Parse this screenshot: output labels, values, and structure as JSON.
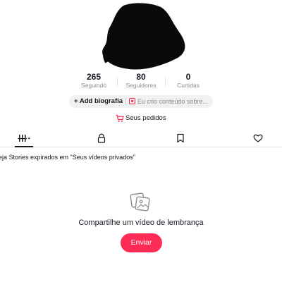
{
  "colors": {
    "accent": "#fe2c55",
    "text_primary": "#161823",
    "text_secondary": "#8a8b91",
    "pill_bg": "#f1f1f2"
  },
  "profile": {
    "avatar": "redacted-avatar"
  },
  "stats": [
    {
      "value": "265",
      "label": "Seguindo"
    },
    {
      "value": "80",
      "label": "Seguidores"
    },
    {
      "value": "0",
      "label": "Curtidas"
    }
  ],
  "bio": {
    "add_label": "+ Add biografia",
    "suggestion_icon": "square-badge-icon",
    "suggestion_text": "Eu crio conteúdo sobre..."
  },
  "orders": {
    "icon": "cart-icon",
    "label": "Seus pedidos"
  },
  "tabs": [
    {
      "name": "videos",
      "icon": "grid-bars-icon",
      "active": true
    },
    {
      "name": "private",
      "icon": "lock-icon",
      "active": false
    },
    {
      "name": "saved",
      "icon": "bookmark-icon",
      "active": false
    },
    {
      "name": "liked",
      "icon": "heart-icon",
      "active": false
    }
  ],
  "notice": "eja Stories expirados em \"Seus vídeos privados\"",
  "empty_state": {
    "icon": "photo-stack-icon",
    "title": "Compartilhe um vídeo de lembrança",
    "button_label": "Enviar"
  }
}
